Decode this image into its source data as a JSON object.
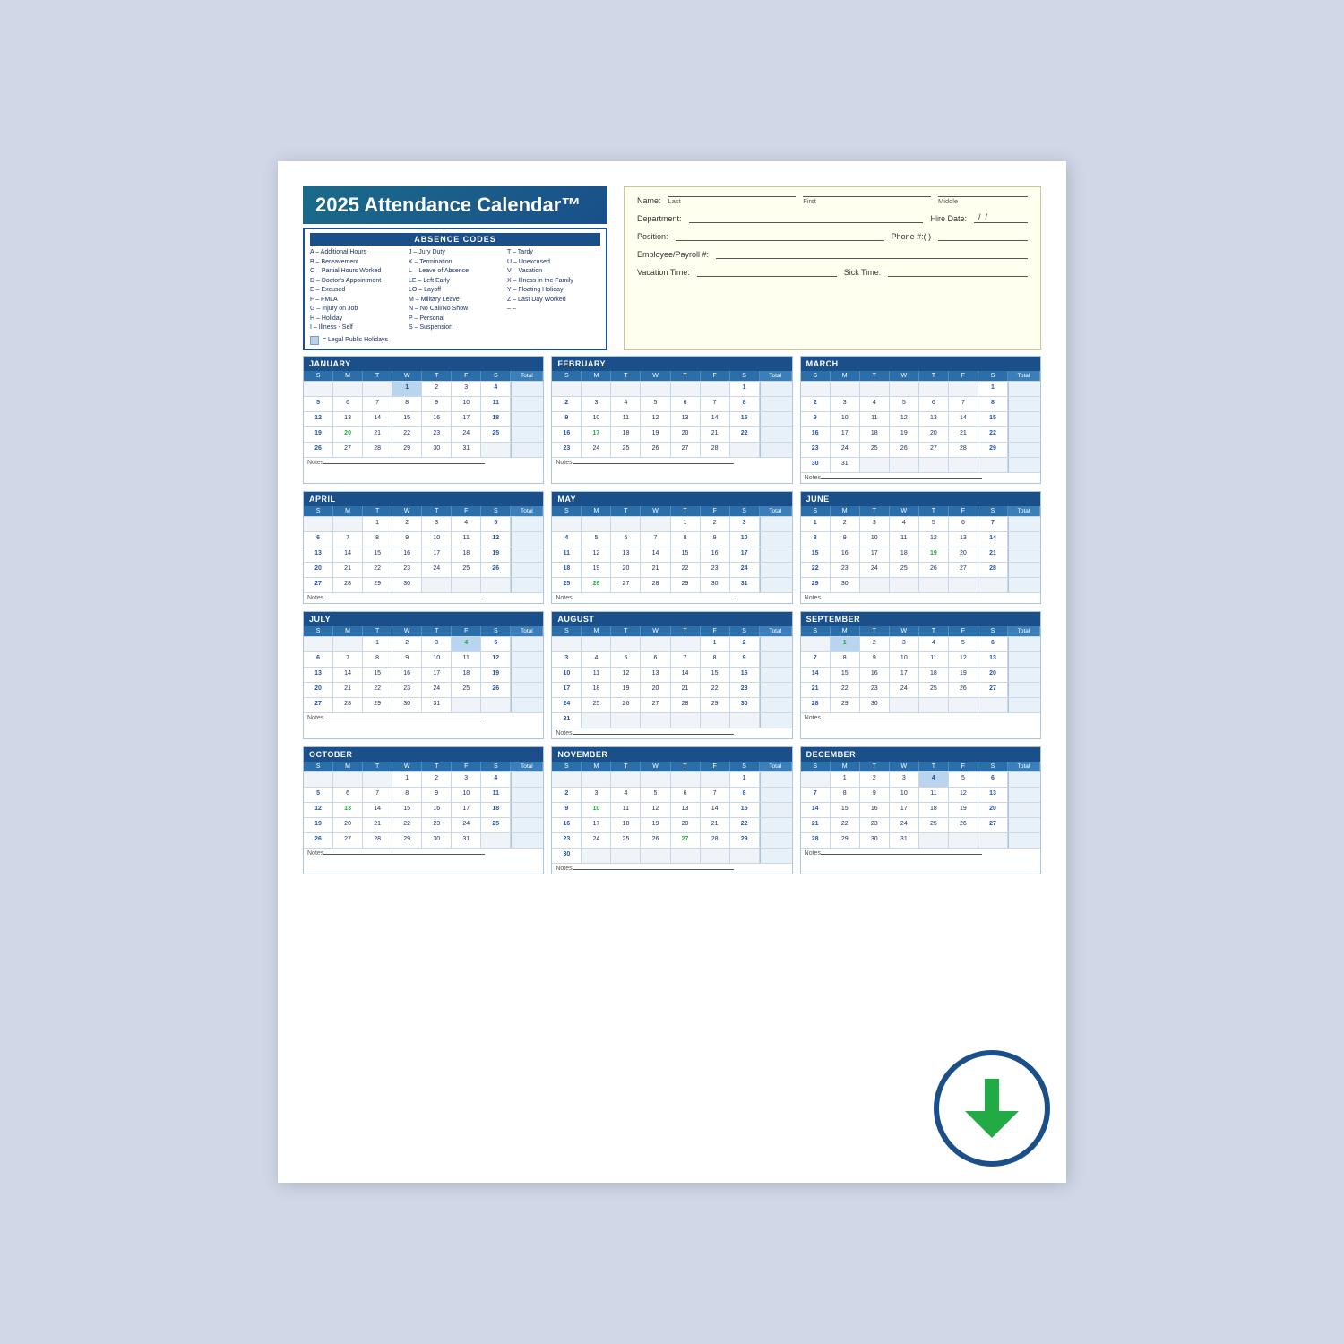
{
  "title": "2025 Attendance Calendar™",
  "absence_codes": {
    "heading": "ABSENCE CODES",
    "col1": [
      "A – Additional Hours",
      "B – Bereavement",
      "C – Partial Hours Worked",
      "D – Doctor's Appointment",
      "E – Excused",
      "F – FMLA",
      "G – Injury on Job",
      "H – Holiday",
      "I  – Illness - Self"
    ],
    "col2": [
      "J  – Jury Duty",
      "K – Termination",
      "L  – Leave of Absence",
      "LE – Left Early",
      "LO – Layoff",
      "M – Military Leave",
      "N – No Call/No Show",
      "P  – Personal",
      "S  – Suspension"
    ],
    "col3": [
      "T – Tardy",
      "U – Unexcused",
      "V – Vacation",
      "X – Illness in the Family",
      "Y – Floating Holiday",
      "Z – Last Day Worked",
      "– –",
      ""
    ],
    "legend": "= Legal Public Holidays"
  },
  "employee_form": {
    "name_label": "Name:",
    "last_label": "Last",
    "first_label": "First",
    "middle_label": "Middle",
    "dept_label": "Department:",
    "hire_label": "Hire Date:",
    "hire_placeholder": "  /  /",
    "position_label": "Position:",
    "phone_label": "Phone #:(   )",
    "payroll_label": "Employee/Payroll #:",
    "vacation_label": "Vacation Time:",
    "sick_label": "Sick Time:"
  },
  "months": [
    {
      "name": "JANUARY",
      "days_header": [
        "S",
        "M",
        "T",
        "W",
        "T",
        "F",
        "S",
        "Total"
      ],
      "weeks": [
        [
          "",
          "",
          "",
          "1",
          "2",
          "3",
          "4",
          ""
        ],
        [
          "5",
          "6",
          "7",
          "8",
          "9",
          "10",
          "11",
          ""
        ],
        [
          "12",
          "13",
          "14",
          "15",
          "16",
          "17",
          "18",
          ""
        ],
        [
          "19",
          "20",
          "21",
          "22",
          "23",
          "24",
          "25",
          ""
        ],
        [
          "26",
          "27",
          "28",
          "29",
          "30",
          "31",
          "",
          ""
        ]
      ],
      "holiday_cells": [
        {
          "week": 0,
          "day": 3
        }
      ],
      "highlight_cells": [
        {
          "week": 3,
          "day": 1,
          "class": "hl-green"
        }
      ]
    },
    {
      "name": "FEBRUARY",
      "weeks": [
        [
          "",
          "",
          "",
          "",
          "",
          "",
          "1",
          ""
        ],
        [
          "2",
          "3",
          "4",
          "5",
          "6",
          "7",
          "8",
          ""
        ],
        [
          "9",
          "10",
          "11",
          "12",
          "13",
          "14",
          "15",
          ""
        ],
        [
          "16",
          "17",
          "18",
          "19",
          "20",
          "21",
          "22",
          ""
        ],
        [
          "23",
          "24",
          "25",
          "26",
          "27",
          "28",
          "",
          ""
        ]
      ],
      "holiday_cells": [],
      "highlight_cells": [
        {
          "week": 3,
          "day": 1,
          "class": "hl-green"
        }
      ]
    },
    {
      "name": "MARCH",
      "weeks": [
        [
          "",
          "",
          "",
          "",
          "",
          "",
          "1",
          ""
        ],
        [
          "2",
          "3",
          "4",
          "5",
          "6",
          "7",
          "8",
          ""
        ],
        [
          "9",
          "10",
          "11",
          "12",
          "13",
          "14",
          "15",
          ""
        ],
        [
          "16",
          "17",
          "18",
          "19",
          "20",
          "21",
          "22",
          ""
        ],
        [
          "23",
          "24",
          "25",
          "26",
          "27",
          "28",
          "29",
          ""
        ],
        [
          "30",
          "31",
          "",
          "",
          "",
          "",
          "",
          ""
        ]
      ],
      "holiday_cells": [],
      "highlight_cells": []
    },
    {
      "name": "APRIL",
      "weeks": [
        [
          "",
          "",
          "1",
          "2",
          "3",
          "4",
          "5",
          ""
        ],
        [
          "6",
          "7",
          "8",
          "9",
          "10",
          "11",
          "12",
          ""
        ],
        [
          "13",
          "14",
          "15",
          "16",
          "17",
          "18",
          "19",
          ""
        ],
        [
          "20",
          "21",
          "22",
          "23",
          "24",
          "25",
          "26",
          ""
        ],
        [
          "27",
          "28",
          "29",
          "30",
          "",
          "",
          "",
          ""
        ]
      ],
      "holiday_cells": [],
      "highlight_cells": []
    },
    {
      "name": "MAY",
      "weeks": [
        [
          "",
          "",
          "",
          "",
          "1",
          "2",
          "3",
          ""
        ],
        [
          "4",
          "5",
          "6",
          "7",
          "8",
          "9",
          "10",
          ""
        ],
        [
          "11",
          "12",
          "13",
          "14",
          "15",
          "16",
          "17",
          ""
        ],
        [
          "18",
          "19",
          "20",
          "21",
          "22",
          "23",
          "24",
          ""
        ],
        [
          "25",
          "26",
          "27",
          "28",
          "29",
          "30",
          "31",
          ""
        ]
      ],
      "holiday_cells": [],
      "highlight_cells": [
        {
          "week": 4,
          "day": 1,
          "class": "hl-green"
        }
      ]
    },
    {
      "name": "JUNE",
      "weeks": [
        [
          "1",
          "2",
          "3",
          "4",
          "5",
          "6",
          "7",
          ""
        ],
        [
          "8",
          "9",
          "10",
          "11",
          "12",
          "13",
          "14",
          ""
        ],
        [
          "15",
          "16",
          "17",
          "18",
          "19",
          "20",
          "21",
          ""
        ],
        [
          "22",
          "23",
          "24",
          "25",
          "26",
          "27",
          "28",
          ""
        ],
        [
          "29",
          "30",
          "",
          "",
          "",
          "",
          "",
          ""
        ]
      ],
      "holiday_cells": [],
      "highlight_cells": [
        {
          "week": 2,
          "day": 4,
          "class": "hl-green"
        }
      ]
    },
    {
      "name": "JULY",
      "weeks": [
        [
          "",
          "",
          "1",
          "2",
          "3",
          "4",
          "5",
          ""
        ],
        [
          "6",
          "7",
          "8",
          "9",
          "10",
          "11",
          "12",
          ""
        ],
        [
          "13",
          "14",
          "15",
          "16",
          "17",
          "18",
          "19",
          ""
        ],
        [
          "20",
          "21",
          "22",
          "23",
          "24",
          "25",
          "26",
          ""
        ],
        [
          "27",
          "28",
          "29",
          "30",
          "31",
          "",
          "",
          ""
        ]
      ],
      "holiday_cells": [
        {
          "week": 0,
          "day": 5
        }
      ],
      "highlight_cells": [
        {
          "week": 0,
          "day": 5,
          "class": "hl-green"
        }
      ]
    },
    {
      "name": "AUGUST",
      "weeks": [
        [
          "",
          "",
          "",
          "",
          "",
          "1",
          "2",
          ""
        ],
        [
          "3",
          "4",
          "5",
          "6",
          "7",
          "8",
          "9",
          ""
        ],
        [
          "10",
          "11",
          "12",
          "13",
          "14",
          "15",
          "16",
          ""
        ],
        [
          "17",
          "18",
          "19",
          "20",
          "21",
          "22",
          "23",
          ""
        ],
        [
          "24",
          "25",
          "26",
          "27",
          "28",
          "29",
          "30",
          ""
        ],
        [
          "31",
          "",
          "",
          "",
          "",
          "",
          "",
          ""
        ]
      ],
      "holiday_cells": [],
      "highlight_cells": []
    },
    {
      "name": "SEPTEMBER",
      "weeks": [
        [
          "",
          "1",
          "2",
          "3",
          "4",
          "5",
          "6",
          ""
        ],
        [
          "7",
          "8",
          "9",
          "10",
          "11",
          "12",
          "13",
          ""
        ],
        [
          "14",
          "15",
          "16",
          "17",
          "18",
          "19",
          "20",
          ""
        ],
        [
          "21",
          "22",
          "23",
          "24",
          "25",
          "26",
          "27",
          ""
        ],
        [
          "28",
          "29",
          "30",
          "",
          "",
          "",
          "",
          ""
        ]
      ],
      "holiday_cells": [
        {
          "week": 0,
          "day": 1
        }
      ],
      "highlight_cells": [
        {
          "week": 0,
          "day": 1,
          "class": "hl-green"
        }
      ]
    },
    {
      "name": "OCTOBER",
      "weeks": [
        [
          "",
          "",
          "",
          "1",
          "2",
          "3",
          "4",
          ""
        ],
        [
          "5",
          "6",
          "7",
          "8",
          "9",
          "10",
          "11",
          ""
        ],
        [
          "12",
          "13",
          "14",
          "15",
          "16",
          "17",
          "18",
          ""
        ],
        [
          "19",
          "20",
          "21",
          "22",
          "23",
          "24",
          "25",
          ""
        ],
        [
          "26",
          "27",
          "28",
          "29",
          "30",
          "31",
          "",
          ""
        ]
      ],
      "holiday_cells": [],
      "highlight_cells": [
        {
          "week": 2,
          "day": 1,
          "class": "hl-green"
        }
      ]
    },
    {
      "name": "NOVEMBER",
      "weeks": [
        [
          "",
          "",
          "",
          "",
          "",
          "",
          "1",
          ""
        ],
        [
          "2",
          "3",
          "4",
          "5",
          "6",
          "7",
          "8",
          ""
        ],
        [
          "9",
          "10",
          "11",
          "12",
          "13",
          "14",
          "15",
          ""
        ],
        [
          "16",
          "17",
          "18",
          "19",
          "20",
          "21",
          "22",
          ""
        ],
        [
          "23",
          "24",
          "25",
          "26",
          "27",
          "28",
          "29",
          ""
        ],
        [
          "30",
          "",
          "",
          "",
          "",
          "",
          "",
          ""
        ]
      ],
      "holiday_cells": [],
      "highlight_cells": [
        {
          "week": 2,
          "day": 1,
          "class": "hl-green"
        },
        {
          "week": 4,
          "day": 4,
          "class": "hl-green"
        }
      ]
    },
    {
      "name": "DECEMBER",
      "weeks": [
        [
          "",
          "1",
          "2",
          "3",
          "4",
          "5",
          "6",
          ""
        ],
        [
          "7",
          "8",
          "9",
          "10",
          "11",
          "12",
          "13",
          ""
        ],
        [
          "14",
          "15",
          "16",
          "17",
          "18",
          "19",
          "20",
          ""
        ],
        [
          "21",
          "22",
          "23",
          "24",
          "25",
          "26",
          "27",
          ""
        ],
        [
          "28",
          "29",
          "30",
          "31",
          "",
          "",
          "",
          ""
        ]
      ],
      "holiday_cells": [
        {
          "week": 0,
          "day": 4
        }
      ],
      "highlight_cells": []
    }
  ],
  "notes_label": "Notes",
  "download_icon": "⬇"
}
